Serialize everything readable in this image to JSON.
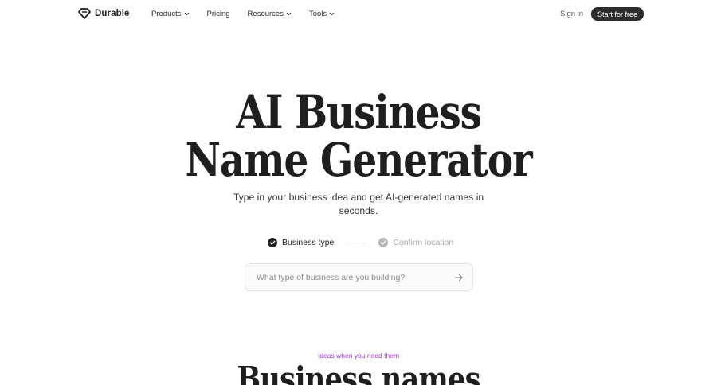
{
  "brand": {
    "name": "Durable",
    "logo_icon": "durable-logo-icon"
  },
  "nav": {
    "items": [
      {
        "label": "Products",
        "has_dropdown": true
      },
      {
        "label": "Pricing",
        "has_dropdown": false
      },
      {
        "label": "Resources",
        "has_dropdown": true
      },
      {
        "label": "Tools",
        "has_dropdown": true
      }
    ],
    "sign_in": "Sign in",
    "cta": "Start for free"
  },
  "hero": {
    "title_line1": "AI Business",
    "title_line2": "Name Generator",
    "subtitle": "Type in your business idea and get AI-generated names in seconds."
  },
  "steps": [
    {
      "label": "Business type",
      "state": "active",
      "icon": "check-circle-icon"
    },
    {
      "label": "Confirm location",
      "state": "inactive",
      "icon": "check-circle-icon"
    }
  ],
  "search": {
    "placeholder": "What type of business are you building?",
    "value": "",
    "submit_icon": "arrow-right-icon"
  },
  "section": {
    "eyebrow": "Ideas when you need them",
    "title": "Business names"
  },
  "colors": {
    "text_primary": "#1f1f1f",
    "cta_background": "#2e2e2e",
    "eyebrow_accent": "#a12fd0",
    "inactive_step": "#a9a9a9"
  }
}
